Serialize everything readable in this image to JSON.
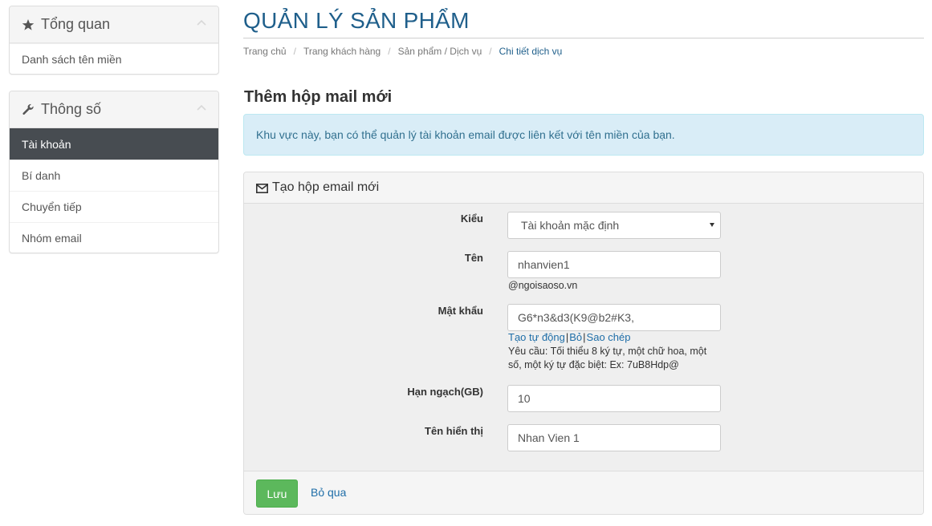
{
  "sidebar": {
    "overview": {
      "title": "Tổng quan",
      "icon": "star-icon",
      "items": [
        {
          "label": "Danh sách tên miền"
        }
      ]
    },
    "settings": {
      "title": "Thông số",
      "icon": "wrench-icon",
      "items": [
        {
          "label": "Tài khoản",
          "active": true
        },
        {
          "label": "Bí danh"
        },
        {
          "label": "Chuyển tiếp"
        },
        {
          "label": "Nhóm email"
        }
      ]
    }
  },
  "page": {
    "title": "QUẢN LÝ SẢN PHẨM",
    "breadcrumb": [
      "Trang chủ",
      "Trang khách hàng",
      "Sản phẩm / Dịch vụ",
      "Chi tiết dịch vụ"
    ],
    "breadcrumb_separator": "/"
  },
  "section": {
    "title": "Thêm hộp mail mới",
    "info": "Khu vực này, bạn có thể quản lý tài khoản email được liên kết với tên miền của bạn."
  },
  "form": {
    "header": "Tạo hộp email mới",
    "header_icon": "envelope-icon",
    "type": {
      "label": "Kiểu",
      "value": "Tài khoản mặc định"
    },
    "name": {
      "label": "Tên",
      "value": "nhanvien1",
      "domain_suffix": "@ngoisaoso.vn"
    },
    "password": {
      "label": "Mật khẩu",
      "value": "G6*n3&d3(K9@b2#K3,",
      "links": [
        "Tạo tự động",
        "Bỏ",
        "Sao chép"
      ],
      "link_separator": "|",
      "requirement_line1": "Yêu cầu: Tối thiểu 8 ký tự, một chữ hoa, một",
      "requirement_line2": "số, một ký tự đặc biệt: Ex: 7uB8Hdp@"
    },
    "quota": {
      "label": "Hạn ngạch(GB)",
      "value": "10"
    },
    "display_name": {
      "label": "Tên hiển thị",
      "value": "Nhan Vien 1"
    },
    "save_label": "Lưu",
    "cancel_label": "Bỏ qua"
  },
  "colors": {
    "title_blue": "#1f5f8b",
    "sidebar_active_bg": "#474c51",
    "alert_bg": "#d9edf7",
    "alert_text": "#31708f",
    "save_green": "#5cb85c",
    "link_blue": "#1f6ea8"
  }
}
